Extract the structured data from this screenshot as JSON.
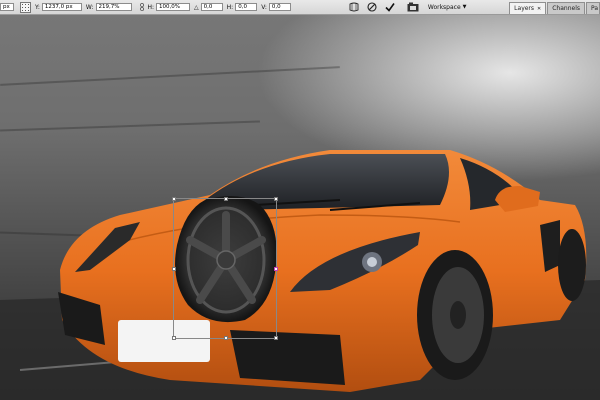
{
  "options_bar": {
    "x_value": "px",
    "y_label": "Y:",
    "y_value": "1237,0 px",
    "w_label": "W:",
    "w_value": "219,7%",
    "h_label": "H:",
    "h_value": "100,0%",
    "rotate_label": "△",
    "rotate_value": "0,0",
    "hskew_label": "H:",
    "hskew_value": "0,0",
    "vskew_label": "V:",
    "vskew_value": "0,0",
    "workspace_label": "Workspace"
  },
  "panel_tabs": {
    "layers": "Layers",
    "channels": "Channels",
    "paths_partial": "Pa"
  },
  "colors": {
    "car_orange": "#e8701f",
    "car_dark": "#b24e10",
    "wheel_dark": "#2d2d2d",
    "handle_accent": "#c43fb5"
  }
}
